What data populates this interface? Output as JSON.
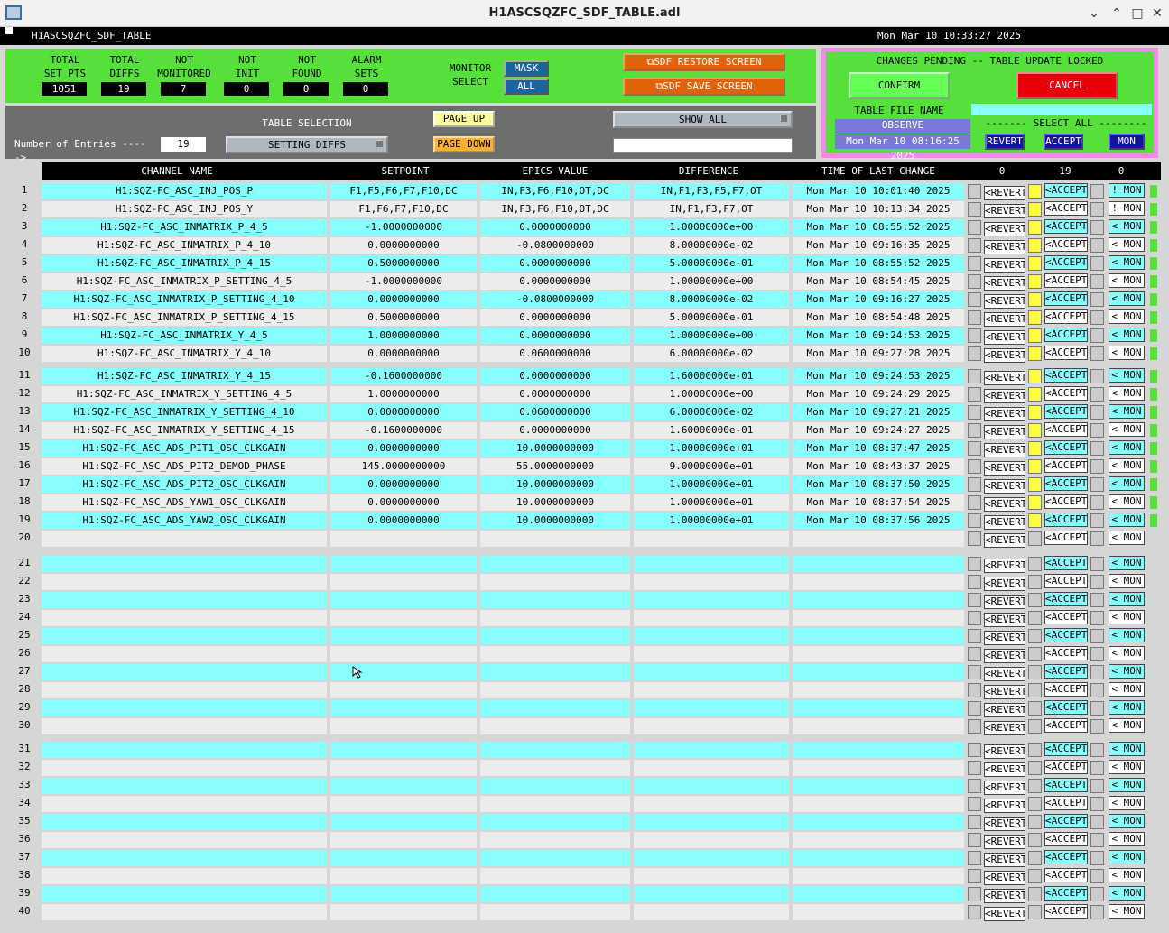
{
  "window": {
    "title": "H1ASCSQZFC_SDF_TABLE.adl"
  },
  "header": {
    "screen_name": "H1ASCSQZFC_SDF_TABLE",
    "datetime": "Mon Mar 10 10:33:27 2025"
  },
  "stats": [
    {
      "label": "TOTAL\nSET PTS",
      "value": "1051"
    },
    {
      "label": "TOTAL\nDIFFS",
      "value": "19"
    },
    {
      "label": "NOT\nMONITORED",
      "value": "7"
    },
    {
      "label": "NOT\nINIT",
      "value": "0"
    },
    {
      "label": "NOT\nFOUND",
      "value": "0"
    },
    {
      "label": "ALARM\nSETS",
      "value": "0"
    }
  ],
  "monitor_select": {
    "label": "MONITOR\nSELECT",
    "mask": "MASK",
    "all": "ALL"
  },
  "sdf_buttons": {
    "restore": "SDF RESTORE SCREEN",
    "save": "SDF SAVE SCREEN"
  },
  "pending": {
    "title": "CHANGES PENDING -- TABLE UPDATE LOCKED",
    "confirm": "CONFIRM",
    "cancel": "CANCEL",
    "file_label": "TABLE FILE NAME",
    "file_value": "",
    "observe": "OBSERVE",
    "file_time": "Mon Mar 10 08:16:25 2025",
    "select_all": "------- SELECT ALL --------",
    "revert": "REVERT",
    "accept": "ACCEPT",
    "mon": "MON"
  },
  "controls": {
    "table_selection_label": "TABLE SELECTION",
    "table_selection_value": "SETTING DIFFS",
    "entries_label": "Number of Entries ----->",
    "entries_value": "19",
    "page_up": "PAGE UP",
    "page_down": "PAGE DOWN",
    "show_all": "SHOW ALL",
    "filter_value": ""
  },
  "columns": {
    "name": "CHANNEL NAME",
    "setpoint": "SETPOINT",
    "epics": "EPICS VALUE",
    "diff": "DIFFERENCE",
    "time": "TIME OF LAST CHANGE",
    "count_revert": "0",
    "count_accept": "19",
    "count_mon": "0"
  },
  "button_labels": {
    "revert": "<REVERT",
    "accept": "<ACCEPT",
    "mon_cfg": "< MON",
    "mon_alt": "! MON"
  },
  "rows": [
    {
      "n": "1",
      "name": "H1:SQZ-FC_ASC_INJ_POS_P",
      "sp": "F1,F5,F6,F7,F10,DC",
      "ev": "IN,F3,F6,F10,OT,DC",
      "df": "IN,F1,F3,F5,F7,OT",
      "tm": "Mon Mar 10 10:01:40 2025",
      "y": true,
      "mon": "! MON"
    },
    {
      "n": "2",
      "name": "H1:SQZ-FC_ASC_INJ_POS_Y",
      "sp": "F1,F6,F7,F10,DC",
      "ev": "IN,F3,F6,F10,OT,DC",
      "df": "IN,F1,F3,F7,OT",
      "tm": "Mon Mar 10 10:13:34 2025",
      "y": true,
      "mon": "! MON"
    },
    {
      "n": "3",
      "name": "H1:SQZ-FC_ASC_INMATRIX_P_4_5",
      "sp": "-1.0000000000",
      "ev": "0.0000000000",
      "df": "1.00000000e+00",
      "tm": "Mon Mar 10 08:55:52 2025",
      "y": true,
      "mon": "< MON"
    },
    {
      "n": "4",
      "name": "H1:SQZ-FC_ASC_INMATRIX_P_4_10",
      "sp": "0.0000000000",
      "ev": "-0.0800000000",
      "df": "8.00000000e-02",
      "tm": "Mon Mar 10 09:16:35 2025",
      "y": true,
      "mon": "< MON"
    },
    {
      "n": "5",
      "name": "H1:SQZ-FC_ASC_INMATRIX_P_4_15",
      "sp": "0.5000000000",
      "ev": "0.0000000000",
      "df": "5.00000000e-01",
      "tm": "Mon Mar 10 08:55:52 2025",
      "y": true,
      "mon": "< MON"
    },
    {
      "n": "6",
      "name": "H1:SQZ-FC_ASC_INMATRIX_P_SETTING_4_5",
      "sp": "-1.0000000000",
      "ev": "0.0000000000",
      "df": "1.00000000e+00",
      "tm": "Mon Mar 10 08:54:45 2025",
      "y": true,
      "mon": "< MON"
    },
    {
      "n": "7",
      "name": "H1:SQZ-FC_ASC_INMATRIX_P_SETTING_4_10",
      "sp": "0.0000000000",
      "ev": "-0.0800000000",
      "df": "8.00000000e-02",
      "tm": "Mon Mar 10 09:16:27 2025",
      "y": true,
      "mon": "< MON"
    },
    {
      "n": "8",
      "name": "H1:SQZ-FC_ASC_INMATRIX_P_SETTING_4_15",
      "sp": "0.5000000000",
      "ev": "0.0000000000",
      "df": "5.00000000e-01",
      "tm": "Mon Mar 10 08:54:48 2025",
      "y": true,
      "mon": "< MON"
    },
    {
      "n": "9",
      "name": "H1:SQZ-FC_ASC_INMATRIX_Y_4_5",
      "sp": "1.0000000000",
      "ev": "0.0000000000",
      "df": "1.00000000e+00",
      "tm": "Mon Mar 10 09:24:53 2025",
      "y": true,
      "mon": "< MON"
    },
    {
      "n": "10",
      "name": "H1:SQZ-FC_ASC_INMATRIX_Y_4_10",
      "sp": "0.0000000000",
      "ev": "0.0600000000",
      "df": "6.00000000e-02",
      "tm": "Mon Mar 10 09:27:28 2025",
      "y": true,
      "mon": "< MON"
    },
    {
      "n": "11",
      "name": "H1:SQZ-FC_ASC_INMATRIX_Y_4_15",
      "sp": "-0.1600000000",
      "ev": "0.0000000000",
      "df": "1.60000000e-01",
      "tm": "Mon Mar 10 09:24:53 2025",
      "y": true,
      "mon": "< MON"
    },
    {
      "n": "12",
      "name": "H1:SQZ-FC_ASC_INMATRIX_Y_SETTING_4_5",
      "sp": "1.0000000000",
      "ev": "0.0000000000",
      "df": "1.00000000e+00",
      "tm": "Mon Mar 10 09:24:29 2025",
      "y": true,
      "mon": "< MON"
    },
    {
      "n": "13",
      "name": "H1:SQZ-FC_ASC_INMATRIX_Y_SETTING_4_10",
      "sp": "0.0000000000",
      "ev": "0.0600000000",
      "df": "6.00000000e-02",
      "tm": "Mon Mar 10 09:27:21 2025",
      "y": true,
      "mon": "< MON"
    },
    {
      "n": "14",
      "name": "H1:SQZ-FC_ASC_INMATRIX_Y_SETTING_4_15",
      "sp": "-0.1600000000",
      "ev": "0.0000000000",
      "df": "1.60000000e-01",
      "tm": "Mon Mar 10 09:24:27 2025",
      "y": true,
      "mon": "< MON"
    },
    {
      "n": "15",
      "name": "H1:SQZ-FC_ASC_ADS_PIT1_OSC_CLKGAIN",
      "sp": "0.0000000000",
      "ev": "10.0000000000",
      "df": "1.00000000e+01",
      "tm": "Mon Mar 10 08:37:47 2025",
      "y": true,
      "mon": "< MON"
    },
    {
      "n": "16",
      "name": "H1:SQZ-FC_ASC_ADS_PIT2_DEMOD_PHASE",
      "sp": "145.0000000000",
      "ev": "55.0000000000",
      "df": "9.00000000e+01",
      "tm": "Mon Mar 10 08:43:37 2025",
      "y": true,
      "mon": "< MON"
    },
    {
      "n": "17",
      "name": "H1:SQZ-FC_ASC_ADS_PIT2_OSC_CLKGAIN",
      "sp": "0.0000000000",
      "ev": "10.0000000000",
      "df": "1.00000000e+01",
      "tm": "Mon Mar 10 08:37:50 2025",
      "y": true,
      "mon": "< MON"
    },
    {
      "n": "18",
      "name": "H1:SQZ-FC_ASC_ADS_YAW1_OSC_CLKGAIN",
      "sp": "0.0000000000",
      "ev": "10.0000000000",
      "df": "1.00000000e+01",
      "tm": "Mon Mar 10 08:37:54 2025",
      "y": true,
      "mon": "< MON"
    },
    {
      "n": "19",
      "name": "H1:SQZ-FC_ASC_ADS_YAW2_OSC_CLKGAIN",
      "sp": "0.0000000000",
      "ev": "10.0000000000",
      "df": "1.00000000e+01",
      "tm": "Mon Mar 10 08:37:56 2025",
      "y": true,
      "mon": "< MON"
    },
    {
      "n": "20",
      "name": "",
      "sp": "",
      "ev": "",
      "df": "",
      "tm": "",
      "y": false,
      "mon": "< MON"
    },
    {
      "n": "21",
      "name": "",
      "sp": "",
      "ev": "",
      "df": "",
      "tm": "",
      "y": false,
      "mon": "< MON"
    },
    {
      "n": "22",
      "name": "",
      "sp": "",
      "ev": "",
      "df": "",
      "tm": "",
      "y": false,
      "mon": "< MON"
    },
    {
      "n": "23",
      "name": "",
      "sp": "",
      "ev": "",
      "df": "",
      "tm": "",
      "y": false,
      "mon": "< MON"
    },
    {
      "n": "24",
      "name": "",
      "sp": "",
      "ev": "",
      "df": "",
      "tm": "",
      "y": false,
      "mon": "< MON"
    },
    {
      "n": "25",
      "name": "",
      "sp": "",
      "ev": "",
      "df": "",
      "tm": "",
      "y": false,
      "mon": "< MON"
    },
    {
      "n": "26",
      "name": "",
      "sp": "",
      "ev": "",
      "df": "",
      "tm": "",
      "y": false,
      "mon": "< MON"
    },
    {
      "n": "27",
      "name": "",
      "sp": "",
      "ev": "",
      "df": "",
      "tm": "",
      "y": false,
      "mon": "< MON"
    },
    {
      "n": "28",
      "name": "",
      "sp": "",
      "ev": "",
      "df": "",
      "tm": "",
      "y": false,
      "mon": "< MON"
    },
    {
      "n": "29",
      "name": "",
      "sp": "",
      "ev": "",
      "df": "",
      "tm": "",
      "y": false,
      "mon": "< MON"
    },
    {
      "n": "30",
      "name": "",
      "sp": "",
      "ev": "",
      "df": "",
      "tm": "",
      "y": false,
      "mon": "< MON"
    },
    {
      "n": "31",
      "name": "",
      "sp": "",
      "ev": "",
      "df": "",
      "tm": "",
      "y": false,
      "mon": "< MON"
    },
    {
      "n": "32",
      "name": "",
      "sp": "",
      "ev": "",
      "df": "",
      "tm": "",
      "y": false,
      "mon": "< MON"
    },
    {
      "n": "33",
      "name": "",
      "sp": "",
      "ev": "",
      "df": "",
      "tm": "",
      "y": false,
      "mon": "< MON"
    },
    {
      "n": "34",
      "name": "",
      "sp": "",
      "ev": "",
      "df": "",
      "tm": "",
      "y": false,
      "mon": "< MON"
    },
    {
      "n": "35",
      "name": "",
      "sp": "",
      "ev": "",
      "df": "",
      "tm": "",
      "y": false,
      "mon": "< MON"
    },
    {
      "n": "36",
      "name": "",
      "sp": "",
      "ev": "",
      "df": "",
      "tm": "",
      "y": false,
      "mon": "< MON"
    },
    {
      "n": "37",
      "name": "",
      "sp": "",
      "ev": "",
      "df": "",
      "tm": "",
      "y": false,
      "mon": "< MON"
    },
    {
      "n": "38",
      "name": "",
      "sp": "",
      "ev": "",
      "df": "",
      "tm": "",
      "y": false,
      "mon": "< MON"
    },
    {
      "n": "39",
      "name": "",
      "sp": "",
      "ev": "",
      "df": "",
      "tm": "",
      "y": false,
      "mon": "< MON"
    },
    {
      "n": "40",
      "name": "",
      "sp": "",
      "ev": "",
      "df": "",
      "tm": "",
      "y": false,
      "mon": "< MON"
    }
  ],
  "colors": {
    "green": "#55e03a",
    "cyan": "#88ffff",
    "orange": "#e0620a",
    "red": "#e8000c",
    "navy": "#1414a0",
    "yellow": "#ffff40",
    "pink": "#f08ce8"
  }
}
